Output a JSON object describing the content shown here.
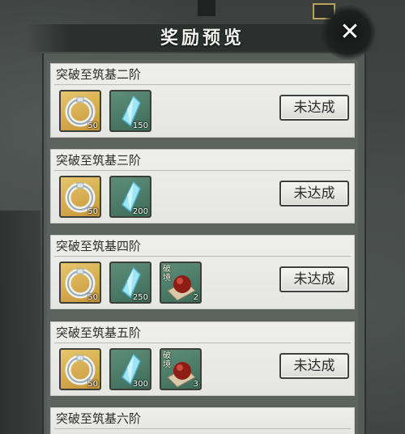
{
  "dialog": {
    "title": "奖励预览",
    "close_icon": "close-icon"
  },
  "rewards": [
    {
      "title": "突破至筑基二阶",
      "status": "未达成",
      "items": [
        {
          "icon": "ring-icon",
          "qty": "50"
        },
        {
          "icon": "crystal-icon",
          "qty": "150"
        }
      ]
    },
    {
      "title": "突破至筑基三阶",
      "status": "未达成",
      "items": [
        {
          "icon": "ring-icon",
          "qty": "50"
        },
        {
          "icon": "crystal-icon",
          "qty": "200"
        }
      ]
    },
    {
      "title": "突破至筑基四阶",
      "status": "未达成",
      "items": [
        {
          "icon": "ring-icon",
          "qty": "50"
        },
        {
          "icon": "crystal-icon",
          "qty": "250"
        },
        {
          "icon": "breakthrough-pill-icon",
          "tag": "破境",
          "qty": "2"
        }
      ]
    },
    {
      "title": "突破至筑基五阶",
      "status": "未达成",
      "items": [
        {
          "icon": "ring-icon",
          "qty": "50"
        },
        {
          "icon": "crystal-icon",
          "qty": "300"
        },
        {
          "icon": "breakthrough-pill-icon",
          "tag": "破境",
          "qty": "3"
        }
      ]
    },
    {
      "title": "突破至筑基六阶"
    }
  ],
  "colors": {
    "card_bg": "#e5e6e1",
    "gold_slot": "#d9ad55",
    "green_slot": "#4e7e6a",
    "panel": "#5c625e"
  }
}
